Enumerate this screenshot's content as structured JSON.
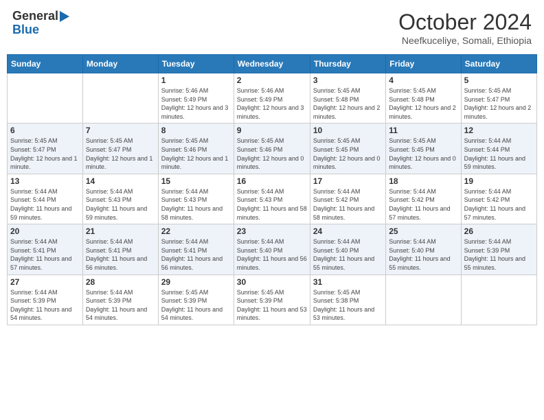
{
  "logo": {
    "general": "General",
    "blue": "Blue"
  },
  "title": "October 2024",
  "subtitle": "Neefkuceliye, Somali, Ethiopia",
  "days_header": [
    "Sunday",
    "Monday",
    "Tuesday",
    "Wednesday",
    "Thursday",
    "Friday",
    "Saturday"
  ],
  "weeks": [
    [
      {
        "day": "",
        "info": ""
      },
      {
        "day": "",
        "info": ""
      },
      {
        "day": "1",
        "info": "Sunrise: 5:46 AM\nSunset: 5:49 PM\nDaylight: 12 hours and 3 minutes."
      },
      {
        "day": "2",
        "info": "Sunrise: 5:46 AM\nSunset: 5:49 PM\nDaylight: 12 hours and 3 minutes."
      },
      {
        "day": "3",
        "info": "Sunrise: 5:45 AM\nSunset: 5:48 PM\nDaylight: 12 hours and 2 minutes."
      },
      {
        "day": "4",
        "info": "Sunrise: 5:45 AM\nSunset: 5:48 PM\nDaylight: 12 hours and 2 minutes."
      },
      {
        "day": "5",
        "info": "Sunrise: 5:45 AM\nSunset: 5:47 PM\nDaylight: 12 hours and 2 minutes."
      }
    ],
    [
      {
        "day": "6",
        "info": "Sunrise: 5:45 AM\nSunset: 5:47 PM\nDaylight: 12 hours and 1 minute."
      },
      {
        "day": "7",
        "info": "Sunrise: 5:45 AM\nSunset: 5:47 PM\nDaylight: 12 hours and 1 minute."
      },
      {
        "day": "8",
        "info": "Sunrise: 5:45 AM\nSunset: 5:46 PM\nDaylight: 12 hours and 1 minute."
      },
      {
        "day": "9",
        "info": "Sunrise: 5:45 AM\nSunset: 5:46 PM\nDaylight: 12 hours and 0 minutes."
      },
      {
        "day": "10",
        "info": "Sunrise: 5:45 AM\nSunset: 5:45 PM\nDaylight: 12 hours and 0 minutes."
      },
      {
        "day": "11",
        "info": "Sunrise: 5:45 AM\nSunset: 5:45 PM\nDaylight: 12 hours and 0 minutes."
      },
      {
        "day": "12",
        "info": "Sunrise: 5:44 AM\nSunset: 5:44 PM\nDaylight: 11 hours and 59 minutes."
      }
    ],
    [
      {
        "day": "13",
        "info": "Sunrise: 5:44 AM\nSunset: 5:44 PM\nDaylight: 11 hours and 59 minutes."
      },
      {
        "day": "14",
        "info": "Sunrise: 5:44 AM\nSunset: 5:43 PM\nDaylight: 11 hours and 59 minutes."
      },
      {
        "day": "15",
        "info": "Sunrise: 5:44 AM\nSunset: 5:43 PM\nDaylight: 11 hours and 58 minutes."
      },
      {
        "day": "16",
        "info": "Sunrise: 5:44 AM\nSunset: 5:43 PM\nDaylight: 11 hours and 58 minutes."
      },
      {
        "day": "17",
        "info": "Sunrise: 5:44 AM\nSunset: 5:42 PM\nDaylight: 11 hours and 58 minutes."
      },
      {
        "day": "18",
        "info": "Sunrise: 5:44 AM\nSunset: 5:42 PM\nDaylight: 11 hours and 57 minutes."
      },
      {
        "day": "19",
        "info": "Sunrise: 5:44 AM\nSunset: 5:42 PM\nDaylight: 11 hours and 57 minutes."
      }
    ],
    [
      {
        "day": "20",
        "info": "Sunrise: 5:44 AM\nSunset: 5:41 PM\nDaylight: 11 hours and 57 minutes."
      },
      {
        "day": "21",
        "info": "Sunrise: 5:44 AM\nSunset: 5:41 PM\nDaylight: 11 hours and 56 minutes."
      },
      {
        "day": "22",
        "info": "Sunrise: 5:44 AM\nSunset: 5:41 PM\nDaylight: 11 hours and 56 minutes."
      },
      {
        "day": "23",
        "info": "Sunrise: 5:44 AM\nSunset: 5:40 PM\nDaylight: 11 hours and 56 minutes."
      },
      {
        "day": "24",
        "info": "Sunrise: 5:44 AM\nSunset: 5:40 PM\nDaylight: 11 hours and 55 minutes."
      },
      {
        "day": "25",
        "info": "Sunrise: 5:44 AM\nSunset: 5:40 PM\nDaylight: 11 hours and 55 minutes."
      },
      {
        "day": "26",
        "info": "Sunrise: 5:44 AM\nSunset: 5:39 PM\nDaylight: 11 hours and 55 minutes."
      }
    ],
    [
      {
        "day": "27",
        "info": "Sunrise: 5:44 AM\nSunset: 5:39 PM\nDaylight: 11 hours and 54 minutes."
      },
      {
        "day": "28",
        "info": "Sunrise: 5:44 AM\nSunset: 5:39 PM\nDaylight: 11 hours and 54 minutes."
      },
      {
        "day": "29",
        "info": "Sunrise: 5:45 AM\nSunset: 5:39 PM\nDaylight: 11 hours and 54 minutes."
      },
      {
        "day": "30",
        "info": "Sunrise: 5:45 AM\nSunset: 5:39 PM\nDaylight: 11 hours and 53 minutes."
      },
      {
        "day": "31",
        "info": "Sunrise: 5:45 AM\nSunset: 5:38 PM\nDaylight: 11 hours and 53 minutes."
      },
      {
        "day": "",
        "info": ""
      },
      {
        "day": "",
        "info": ""
      }
    ]
  ]
}
